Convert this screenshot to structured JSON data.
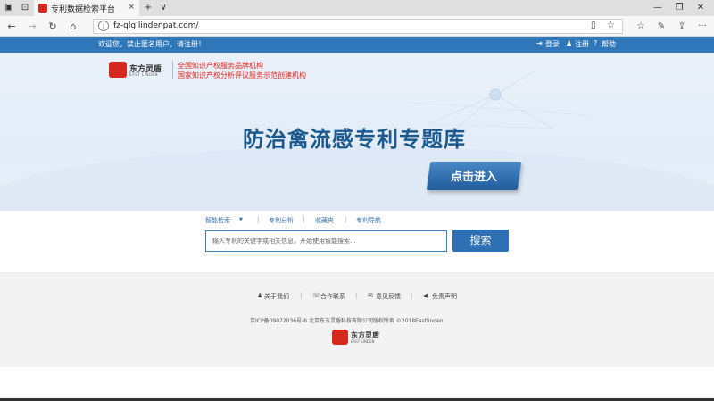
{
  "browser": {
    "tab_title": "专利数据检索平台",
    "url": "fz-qlg.lindenpat.com/",
    "tab_close": "×",
    "new_tab": "+",
    "tab_menu": "∨",
    "back": "←",
    "forward": "→",
    "refresh": "↻",
    "home": "⌂",
    "minimize": "—",
    "restore": "❐",
    "close": "✕",
    "reading": "▯",
    "favorite": "☆",
    "favorites": "☆",
    "notes": "✎",
    "share": "⇪",
    "more": "···"
  },
  "topbar": {
    "welcome": "欢迎您，禁止匿名用户，请注册！",
    "login": "登录",
    "register": "注册",
    "help": "帮助"
  },
  "banner": {
    "logo_text": "东方灵盾",
    "logo_sub": "EAST LINDEN",
    "tagline1": "全国知识产权服务品牌机构",
    "tagline2": "国家知识产权分析评议服务示范创建机构",
    "title": "防治禽流感专利专题库",
    "enter_label": "点击进入"
  },
  "search": {
    "tab_smart": "智能检索",
    "tab_dropdown": "▼",
    "tab_analysis": "专利分析",
    "tab_favorites": "收藏夹",
    "tab_nav": "专利导航",
    "placeholder": "输入专利的关键字或相关信息，开始使用智能搜索...",
    "button": "搜索"
  },
  "footer": {
    "about": "关于我们",
    "contact": "合作联系",
    "feedback": "意见反馈",
    "disclaimer": "免责声明",
    "copyright": "京ICP备09072036号-6 北京东方灵盾科技有限公司版权所有 ©2018Eastlinden",
    "logo_text": "东方灵盾",
    "logo_sub": "EAST LINDEN"
  },
  "colors": {
    "topbar": "#2f77b9",
    "accent_red": "#e1251b",
    "title_blue": "#1a5a8f",
    "button_blue": "#2f6fb3"
  }
}
